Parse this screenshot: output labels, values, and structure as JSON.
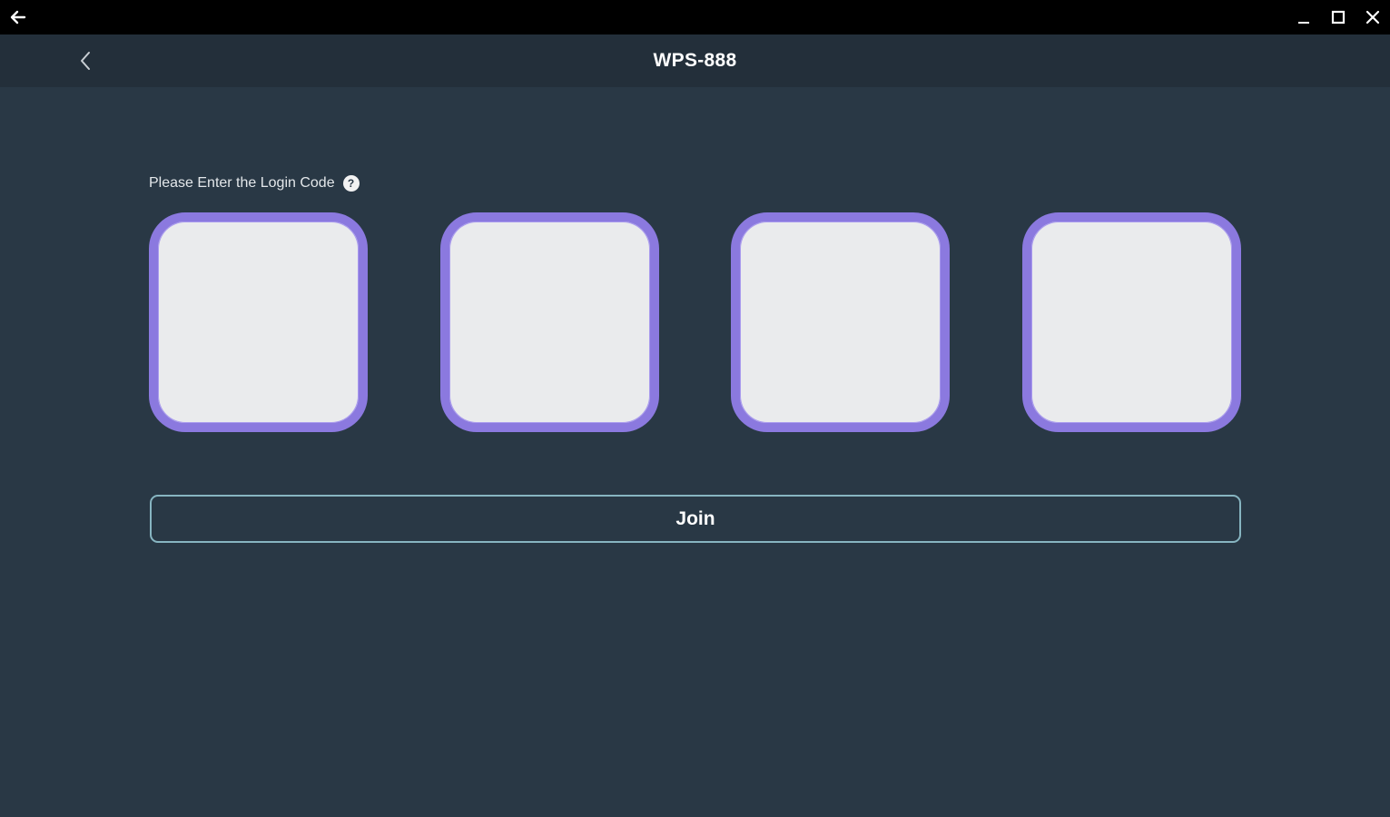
{
  "window": {
    "back_icon": "arrow-left-icon",
    "controls": [
      {
        "name": "minimize-button",
        "icon": "minimize-icon"
      },
      {
        "name": "maximize-button",
        "icon": "maximize-icon"
      },
      {
        "name": "close-button",
        "icon": "close-icon"
      }
    ]
  },
  "header": {
    "title": "WPS-888",
    "back_icon": "chevron-left-icon"
  },
  "login": {
    "prompt": "Please Enter the Login Code",
    "help_icon": "help-icon",
    "help_glyph": "?",
    "code_boxes": [
      "",
      "",
      "",
      ""
    ],
    "join_label": "Join"
  },
  "colors": {
    "background": "#293845",
    "header": "#232f3a",
    "titlebar": "#000000",
    "accent": "#8b79df",
    "box_fill": "#eaebed",
    "button_border": "#87b5c1"
  }
}
